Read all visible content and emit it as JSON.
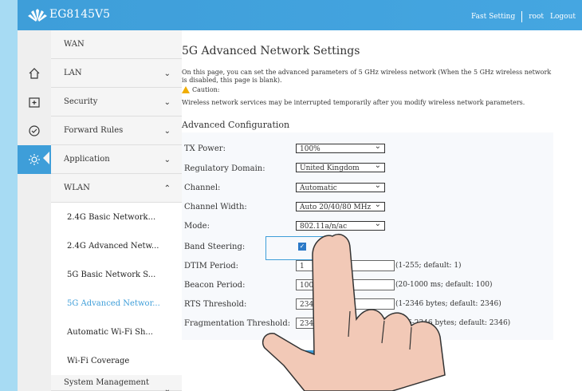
{
  "header": {
    "product": "EG8145V5",
    "links": [
      "Fast Setting",
      "root",
      "Logout"
    ]
  },
  "icons": [
    "home-icon",
    "add-box-icon",
    "check-circle-icon",
    "gear-icon"
  ],
  "menu": {
    "items": [
      {
        "label": "WAN"
      },
      {
        "label": "LAN"
      },
      {
        "label": "Security"
      },
      {
        "label": "Forward Rules"
      },
      {
        "label": "Application"
      },
      {
        "label": "WLAN"
      }
    ],
    "submenu": [
      {
        "label": "2.4G Basic Network..."
      },
      {
        "label": "2.4G Advanced Netw..."
      },
      {
        "label": "5G Basic Network S..."
      },
      {
        "label": "5G Advanced Networ..."
      },
      {
        "label": "Automatic Wi-Fi Sh..."
      },
      {
        "label": "Wi-Fi Coverage"
      }
    ],
    "bottom": "System Management"
  },
  "page": {
    "title": "5G Advanced Network Settings",
    "description": "On this page, you can set the advanced parameters of 5 GHz wireless network (When the 5 GHz wireless network is disabled, this page is blank).",
    "caution_label": "Caution:",
    "caution_text": "Wireless network services may be interrupted temporarily after you modify wireless network parameters.",
    "section": "Advanced Configuration"
  },
  "form": {
    "tx_power": {
      "label": "TX Power:",
      "value": "100%"
    },
    "regulatory": {
      "label": "Regulatory Domain:",
      "value": "United Kingdom"
    },
    "channel": {
      "label": "Channel:",
      "value": "Automatic"
    },
    "channel_width": {
      "label": "Channel Width:",
      "value": "Auto 20/40/80 MHz"
    },
    "mode": {
      "label": "Mode:",
      "value": "802.11a/n/ac"
    },
    "band_steering": {
      "label": "Band Steering:",
      "checked": true
    },
    "dtim": {
      "label": "DTIM Period:",
      "value": "1",
      "hint": "(1-255; default: 1)"
    },
    "beacon": {
      "label": "Beacon Period:",
      "value": "100",
      "hint": "(20-1000 ms; default: 100)"
    },
    "rts": {
      "label": "RTS Threshold:",
      "value": "2346",
      "hint": "(1-2346 bytes; default: 2346)"
    },
    "frag": {
      "label": "Fragmentation Threshold:",
      "value": "2346",
      "hint": "(256-2346 bytes; default: 2346)"
    }
  },
  "buttons": {
    "apply": "Ap"
  },
  "colors": {
    "accent": "#3e9ed9",
    "menu_bg": "#f5f5f5",
    "page_bg": "#a7dbf3"
  }
}
